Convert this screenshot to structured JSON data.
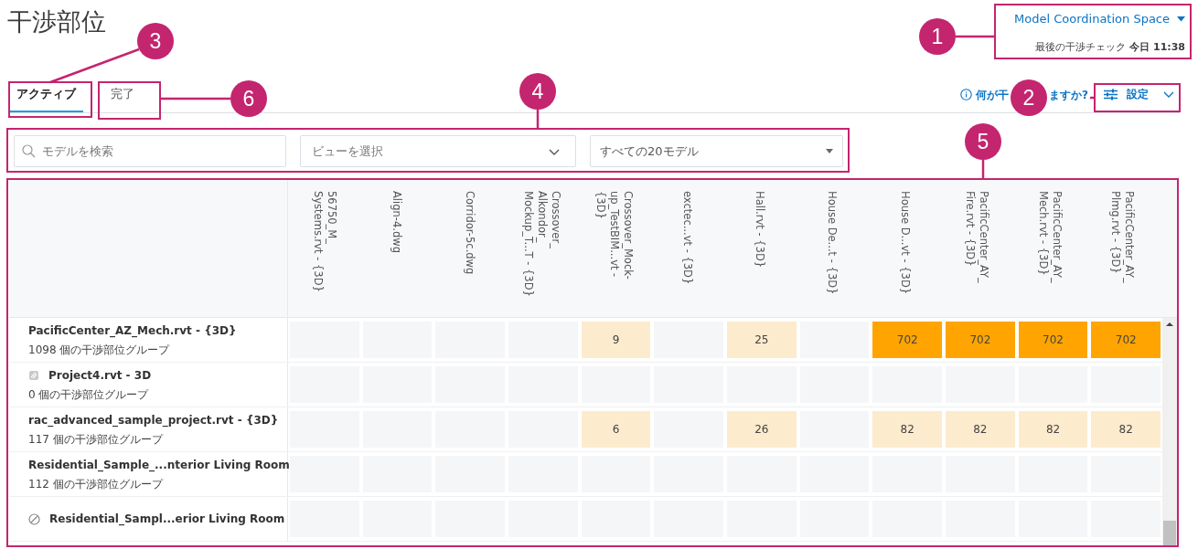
{
  "title": "干渉部位",
  "space": {
    "label": "Model Coordination Space",
    "last_check_label": "最後の干渉チェック",
    "last_check_time": "今日 11:38"
  },
  "tabs": [
    {
      "label": "アクティブ",
      "selected": true
    },
    {
      "label": "完了",
      "selected": false
    }
  ],
  "help_link": {
    "before": "何が干",
    "after": "ますか?"
  },
  "settings": {
    "label": "設定"
  },
  "filters": {
    "search": {
      "placeholder": "モデルを検索"
    },
    "view": {
      "placeholder": "ビューを選択"
    },
    "models": {
      "value": "すべての20モデル"
    }
  },
  "table": {
    "columns": [
      {
        "lines": [
          "56750_M_",
          "Systems.rvt - {3D}"
        ]
      },
      {
        "lines": [
          "Align-4.dwg"
        ]
      },
      {
        "lines": [
          "Corridor-5c.dwg"
        ]
      },
      {
        "lines": [
          "Crossover_",
          "Alkondor_",
          "Mockup_T...T - {3D}"
        ]
      },
      {
        "lines": [
          "Crossover_Mock-",
          "up_TestBIM...vt -",
          "{3D}"
        ]
      },
      {
        "lines": [
          "exctec...vt - {3D}"
        ]
      },
      {
        "lines": [
          "Hall.rvt - {3D}"
        ]
      },
      {
        "lines": [
          "House De...t - {3D}"
        ]
      },
      {
        "lines": [
          "House D...vt - {3D}"
        ]
      },
      {
        "lines": [
          "PacificCenter_AY_",
          "Fire.rvt - {3D}"
        ]
      },
      {
        "lines": [
          "PacificCenter_AY_",
          "Mech.rvt - {3D}"
        ]
      },
      {
        "lines": [
          "PacificCenter_AY_",
          "Plmg.rvt - {3D}"
        ]
      }
    ],
    "rows": [
      {
        "kind": "plain",
        "name": "PacificCenter_AZ_Mech.rvt - {3D}",
        "groups": "1098 個の干渉部位グループ",
        "cells": [
          {
            "kind": "empty"
          },
          {
            "kind": "empty"
          },
          {
            "kind": "empty"
          },
          {
            "kind": "empty"
          },
          {
            "kind": "low",
            "value": "9"
          },
          {
            "kind": "empty"
          },
          {
            "kind": "low",
            "value": "25"
          },
          {
            "kind": "empty"
          },
          {
            "kind": "high",
            "value": "702"
          },
          {
            "kind": "high",
            "value": "702"
          },
          {
            "kind": "high",
            "value": "702"
          },
          {
            "kind": "high",
            "value": "702"
          }
        ]
      },
      {
        "kind": "model",
        "name": "Project4.rvt - 3D",
        "groups": "0 個の干渉部位グループ",
        "cells": [
          {
            "kind": "empty"
          },
          {
            "kind": "empty"
          },
          {
            "kind": "empty"
          },
          {
            "kind": "empty"
          },
          {
            "kind": "empty"
          },
          {
            "kind": "empty"
          },
          {
            "kind": "empty"
          },
          {
            "kind": "empty"
          },
          {
            "kind": "empty"
          },
          {
            "kind": "empty"
          },
          {
            "kind": "empty"
          },
          {
            "kind": "empty"
          }
        ]
      },
      {
        "kind": "plain",
        "name": "rac_advanced_sample_project.rvt - {3D}",
        "groups": "117 個の干渉部位グループ",
        "cells": [
          {
            "kind": "empty"
          },
          {
            "kind": "empty"
          },
          {
            "kind": "empty"
          },
          {
            "kind": "empty"
          },
          {
            "kind": "low",
            "value": "6"
          },
          {
            "kind": "empty"
          },
          {
            "kind": "low",
            "value": "26"
          },
          {
            "kind": "empty"
          },
          {
            "kind": "low",
            "value": "82"
          },
          {
            "kind": "low",
            "value": "82"
          },
          {
            "kind": "low",
            "value": "82"
          },
          {
            "kind": "low",
            "value": "82"
          }
        ]
      },
      {
        "kind": "plain",
        "name": "Residential_Sample_...nterior Living Room",
        "groups": "112 個の干渉部位グループ",
        "cells": [
          {
            "kind": "empty"
          },
          {
            "kind": "empty"
          },
          {
            "kind": "empty"
          },
          {
            "kind": "empty"
          },
          {
            "kind": "empty"
          },
          {
            "kind": "empty"
          },
          {
            "kind": "empty"
          },
          {
            "kind": "empty"
          },
          {
            "kind": "empty"
          },
          {
            "kind": "empty"
          },
          {
            "kind": "empty"
          },
          {
            "kind": "empty"
          }
        ]
      },
      {
        "kind": "blocked",
        "name": "Residential_Sampl...erior Living Room",
        "cells": [
          {
            "kind": "empty"
          },
          {
            "kind": "empty"
          },
          {
            "kind": "empty"
          },
          {
            "kind": "empty"
          },
          {
            "kind": "empty"
          },
          {
            "kind": "empty"
          },
          {
            "kind": "empty"
          },
          {
            "kind": "empty"
          },
          {
            "kind": "empty"
          },
          {
            "kind": "empty"
          },
          {
            "kind": "empty"
          },
          {
            "kind": "empty"
          }
        ]
      }
    ]
  },
  "callouts": [
    {
      "number": "1"
    },
    {
      "number": "2"
    },
    {
      "number": "3"
    },
    {
      "number": "4"
    },
    {
      "number": "5"
    },
    {
      "number": "6"
    }
  ]
}
